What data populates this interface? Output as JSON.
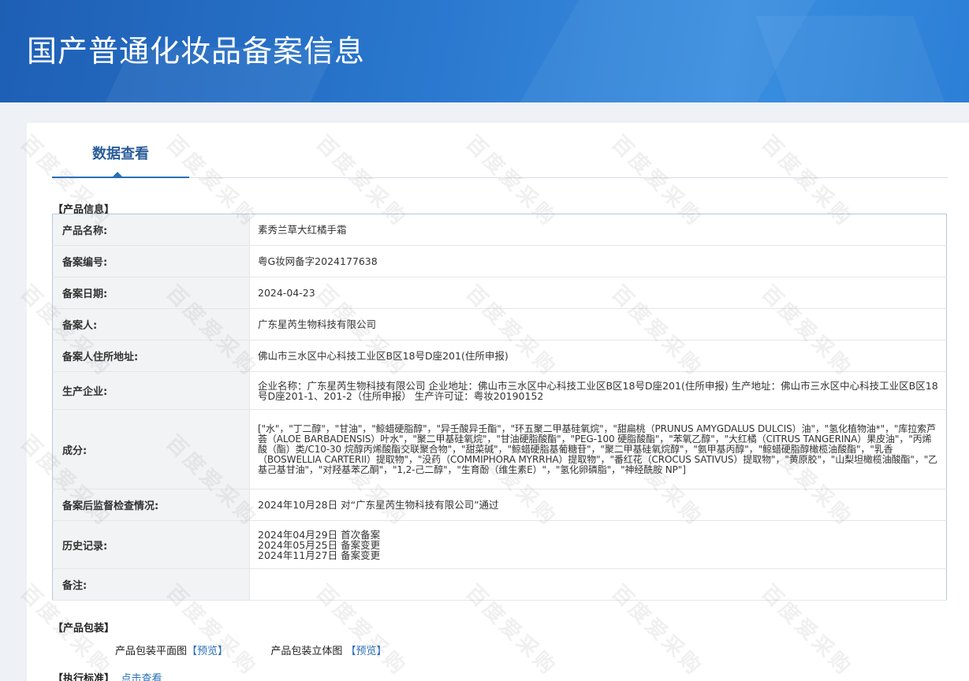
{
  "page_title": "国产普通化妆品备案信息",
  "tab_label": "数据查看",
  "sections": {
    "product_info": "【产品信息】",
    "packaging": "【产品包装】",
    "standard": "【执行标准】"
  },
  "product": {
    "rows": [
      {
        "key": "产品名称:",
        "value": "素秀兰草大红橘手霜"
      },
      {
        "key": "备案编号:",
        "value": "粤G妆网备字2024177638"
      },
      {
        "key": "备案日期:",
        "value": "2024-04-23"
      },
      {
        "key": "备案人:",
        "value": "广东星芮生物科技有限公司"
      },
      {
        "key": "备案人住所地址:",
        "value": "佛山市三水区中心科技工业区B区18号D座201(住所申报)"
      },
      {
        "key": "生产企业:",
        "value": "企业名称：广东星芮生物科技有限公司 企业地址：佛山市三水区中心科技工业区B区18号D座201(住所申报) 生产地址：佛山市三水区中心科技工业区B区18号D座201-1、201-2（住所申报） 生产许可证：粤妆20190152"
      },
      {
        "key": "成分:",
        "value": "[\"水\"，\"丁二醇\"，\"甘油\"，\"鲸蜡硬脂醇\"，\"异壬酸异壬酯\"，\"环五聚二甲基硅氧烷\"，\"甜扁桃（PRUNUS AMYGDALUS DULCIS）油\"，\"氢化植物油*\"，\"库拉索芦荟（ALOE BARBADENSIS）叶水\"，\"聚二甲基硅氧烷\"，\"甘油硬脂酸酯\"，\"PEG-100 硬脂酸酯\"，\"苯氧乙醇\"，\"大红橘（CITRUS TANGERINA）果皮油\"，\"丙烯酸（酯）类/C10-30 烷醇丙烯酸酯交联聚合物\"，\"甜菜碱\"，\"鲸蜡硬脂基葡糖苷\"，\"聚二甲基硅氧烷醇\"，\"氨甲基丙醇\"，\"鲸蜡硬脂醇橄榄油酸酯\"，\"乳香（BOSWELLIA CARTERII）提取物\"，\"没药（COMMIPHORA MYRRHA）提取物\"，\"番红花（CROCUS SATIVUS）提取物\"，\"黄原胶\"，\"山梨坦橄榄油酸酯\"，\"乙基己基甘油\"，\"对羟基苯乙酮\"，\"1,2-己二醇\"，\"生育酚（维生素E）\"，\"氢化卵磷脂\"，\"神经酰胺 NP\"]"
      },
      {
        "key": "备案后监督检查情况:",
        "value": "2024年10月28日 对“广东星芮生物科技有限公司”通过"
      },
      {
        "key": "历史记录:",
        "history": [
          "2024年04月29日 首次备案",
          "2024年05月25日 备案变更",
          "2024年11月27日 备案变更"
        ]
      },
      {
        "key": "备注:",
        "value": ""
      }
    ]
  },
  "packaging": {
    "flat_label": "产品包装平面图",
    "flat_link": "【预览】",
    "solid_label": "产品包装立体图",
    "solid_link": "【预览】"
  },
  "standard": {
    "link": "点击查看"
  },
  "watermark_text": "百度爱采购"
}
